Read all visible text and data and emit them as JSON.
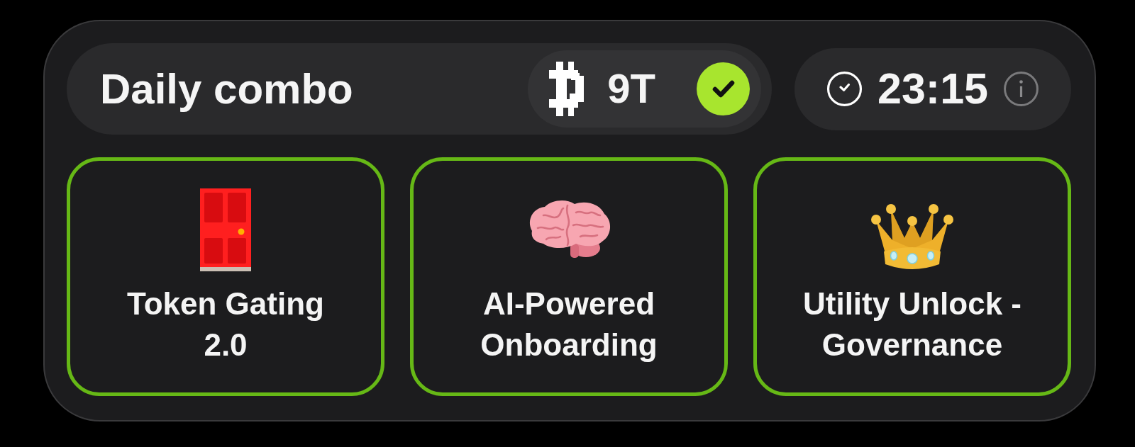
{
  "header": {
    "title": "Daily combo",
    "reward": {
      "amount": "9T",
      "claimed": true
    }
  },
  "timer": {
    "time": "23:15"
  },
  "cards": [
    {
      "kind": "door",
      "label": "Token Gating 2.0",
      "found": true
    },
    {
      "kind": "brain",
      "label": "AI-Powered Onboarding",
      "found": true
    },
    {
      "kind": "crown",
      "label": "Utility Unlock - Governance",
      "found": true
    }
  ]
}
